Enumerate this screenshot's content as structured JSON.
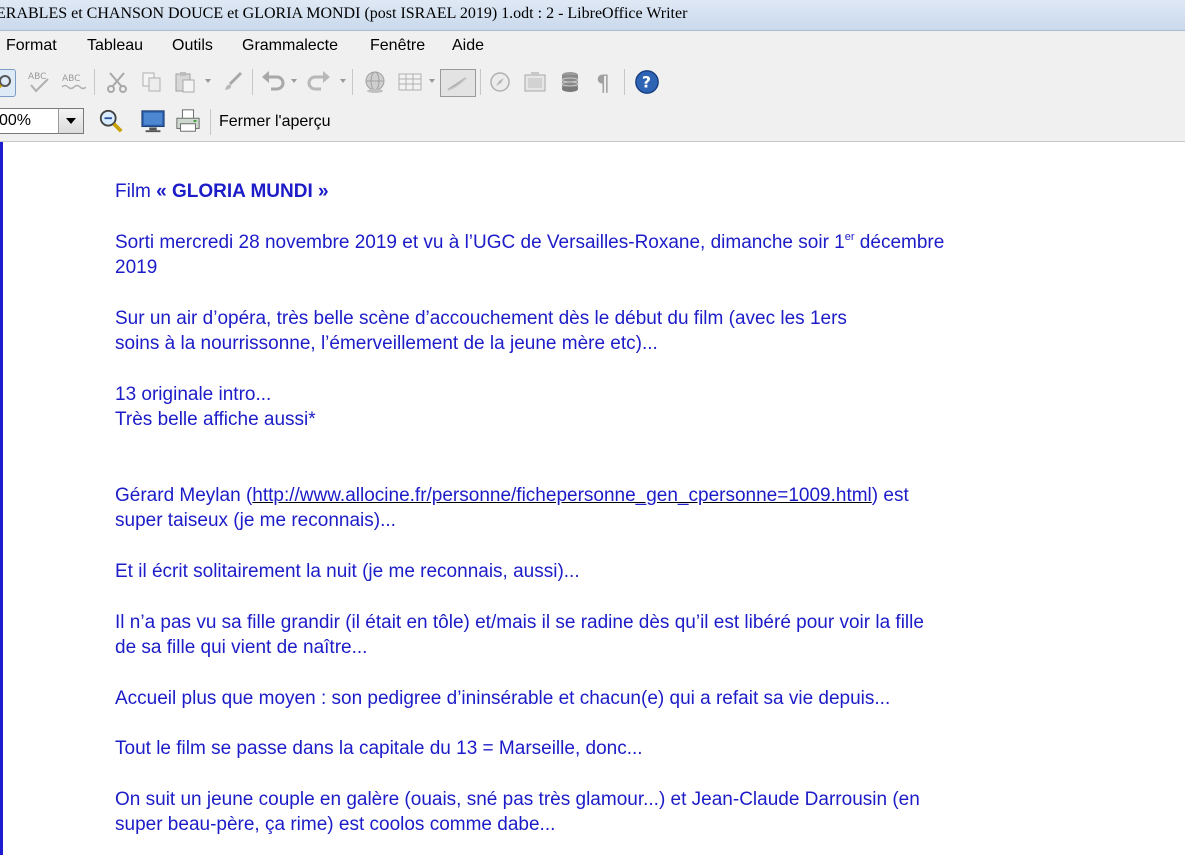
{
  "window": {
    "title": "ERABLES et CHANSON DOUCE et GLORIA MONDI (post ISRAEL 2019)  1.odt : 2 - LibreOffice Writer"
  },
  "menubar": {
    "items": [
      {
        "label": "Format"
      },
      {
        "label": "Tableau"
      },
      {
        "label": "Outils"
      },
      {
        "label": "Grammalecte"
      },
      {
        "label": "Fenêtre"
      },
      {
        "label": "Aide"
      }
    ]
  },
  "toolbar": {
    "icons": [
      "find-icon",
      "spellcheck-icon",
      "autospellcheck-icon",
      "cut-icon",
      "copy-icon",
      "paste-icon",
      "clone-formatting-icon",
      "undo-icon",
      "redo-icon",
      "hyperlink-icon",
      "table-icon",
      "draw-functions-icon",
      "navigator-icon",
      "gallery-icon",
      "data-sources-icon",
      "formatting-marks-icon",
      "help-icon"
    ]
  },
  "preview": {
    "zoom_value": "00%",
    "close_label": "Fermer l'aperçu"
  },
  "document": {
    "p1_prefix": "Film ",
    "p1_bold": "« GLORIA MUNDI »",
    "p2_line1_a": "Sorti mercredi 28 novembre 2019 et vu à l’UGC de Versailles-Roxane, dimanche soir 1",
    "p2_sup": "er",
    "p2_line1_b": " décembre",
    "p2_line2": "2019",
    "p3_line1": "Sur un air d’opéra, très belle scène d’accouchement dès le début du film (avec les 1ers",
    "p3_line2": "soins à la nourrissonne, l’émerveillement de la jeune mère etc)...",
    "p4_line1": "13 originale intro...",
    "p4_line2": "Très belle affiche aussi*",
    "p5_prefix": "Gérard Meylan (",
    "p5_link": "http://www.allocine.fr/personne/fichepersonne_gen_cpersonne=1009.html",
    "p5_suffix": ")  est",
    "p5_line2": "super taiseux (je me reconnais)...",
    "p6": "Et il écrit solitairement la nuit (je me reconnais, aussi)...",
    "p7_line1": "Il n’a pas vu sa fille grandir (il était en tôle) et/mais il se radine dès qu’il est libéré pour voir la fille",
    "p7_line2": "de sa fille qui vient de naître...",
    "p8": "Accueil plus que moyen : son pedigree d’ininsérable et chacun(e) qui a refait sa vie depuis...",
    "p9": "Tout le film se passe dans la capitale du 13 = Marseille, donc...",
    "p10_line1": "On suit un jeune couple en galère (ouais, sné pas très glamour...) et Jean-Claude Darrousin (en",
    "p10_line2": "super beau-père, ça rime) est coolos comme dabe..."
  },
  "colors": {
    "document_text": "#1c1cc8",
    "page_border": "#1d1dcf",
    "chrome_bg": "#f0f0f0"
  }
}
